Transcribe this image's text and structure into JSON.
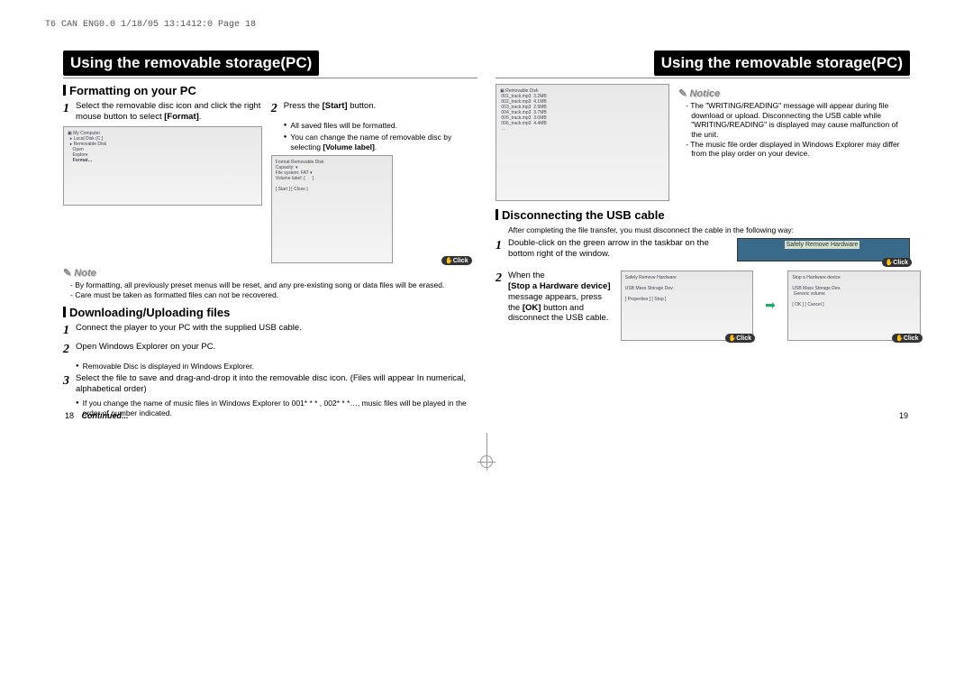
{
  "header_info": "T6 CAN ENG0.0  1/18/05 13:1412:0  Page 18",
  "left": {
    "title": "Using the removable storage(PC)",
    "sec1": {
      "heading": "Formatting on your PC",
      "step1": "Select the removable disc icon and click the right mouse button to select",
      "step1_bold": "Format",
      "step2": "Press the",
      "step2_bold": "[Start]",
      "step2_tail": "button.",
      "b1": "All saved files will be formatted.",
      "b2_a": "You can change the name of removable disc by selecting",
      "b2_b": "[Volume label]"
    },
    "note": {
      "title": "Note",
      "l1": "By formatting, all previously preset menus will be reset, and any pre-existing song or data files will be erased.",
      "l2": "Care must be taken as formatted files can not be recovered."
    },
    "sec2": {
      "heading": "Downloading/Uploading files",
      "s1": "Connect the player to your PC with the supplied USB cable.",
      "s2": "Open Windows Explorer on your PC.",
      "s2b": "Removable Disc is displayed in Windows Explorer.",
      "s3": "Select the file to save and drag-and-drop it into the removable disc icon. (Files will appear In numerical, alphabetical order)",
      "s3b": "If you change the name of music files in Windows Explorer to 001* * * , 002* * *…, music files will be played in the order of number indicated."
    },
    "continued": "Continued...",
    "pg": "18"
  },
  "right": {
    "title": "Using the removable storage(PC)",
    "notice": {
      "title": "Notice",
      "l1": "The \"WRITING/READING\" message will appear during file download or upload. Disconnecting the USB cable while \"WRITING/READING\" is displayed may cause malfunction of the unit.",
      "l2": "The music file order displayed in Windows Explorer may differ from the play order on your device."
    },
    "sec1": {
      "heading": "Disconnecting the USB cable",
      "intro": "After completing the file transfer, you must disconnect the cable in the following way:",
      "s1": "Double-click on the green arrow in the taskbar on the bottom right of the window.",
      "s2a": "When the",
      "s2b": "[Stop a Hardware device]",
      "s2c": "message appears, press the",
      "s2d": "[OK]",
      "s2e": "button and disconnect the USB cable."
    },
    "tray_label": "Safely Remove Hardware",
    "click": "Click",
    "pg": "19"
  }
}
